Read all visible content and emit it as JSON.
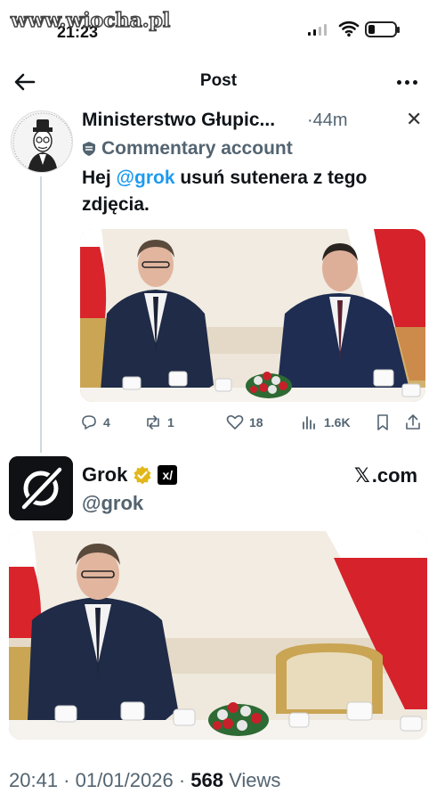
{
  "watermark": "www.wiocha.pl",
  "status": {
    "time": "21:23"
  },
  "header": {
    "title": "Post"
  },
  "post": {
    "author": "Ministerstwo Głupic...",
    "separator": "·",
    "time": "44m",
    "commentary_label": "Commentary account",
    "text_before": "Hej ",
    "mention": "@grok",
    "text_after": " usuń sutenera z tego zdjęcia.",
    "stats": {
      "replies": "4",
      "reposts": "1",
      "likes": "18",
      "views": "1.6K"
    }
  },
  "reply": {
    "name": "Grok",
    "handle": "@grok",
    "site": ".com",
    "timestamp": "20:41 · 01/01/2026 · ",
    "views_count": "568",
    "views_label": " Views"
  },
  "icons": [
    "back-arrow-icon",
    "more-icon",
    "x-close-icon",
    "commentary-shield-icon",
    "reply-icon",
    "repost-icon",
    "like-icon",
    "views-icon",
    "bookmark-icon",
    "share-icon",
    "verified-badge-icon",
    "grok-logo-icon",
    "x-logo-icon"
  ],
  "colors": {
    "link": "#1d9bf0",
    "muted": "#536471",
    "verified": "#e2b719"
  }
}
